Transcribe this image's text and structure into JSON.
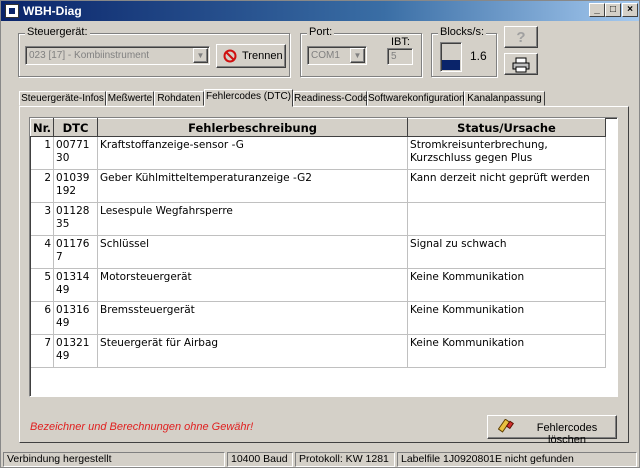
{
  "window": {
    "title": "WBH-Diag",
    "controls": {
      "minimize": "_",
      "maximize": "□",
      "close": "×"
    }
  },
  "controller": {
    "label": "Steuergerät:",
    "value": "023 [17] - Kombiinstrument",
    "disconnect_label": "Trennen"
  },
  "port": {
    "label": "Port:",
    "value": "COM1"
  },
  "ibt": {
    "label": "IBT:",
    "value": "5"
  },
  "blocks": {
    "label": "Blocks/s:",
    "value": "1.6",
    "level": 0.35
  },
  "tabs": [
    {
      "label": "Steuergeräte-Infos"
    },
    {
      "label": "Meßwerte"
    },
    {
      "label": "Rohdaten"
    },
    {
      "label": "Fehlercodes (DTC)"
    },
    {
      "label": "Readiness-Code"
    },
    {
      "label": "Softwarekonfiguration"
    },
    {
      "label": "Kanalanpassung"
    }
  ],
  "dtc_table": {
    "headers": [
      "Nr.",
      "DTC",
      "Fehlerbeschreibung",
      "Status/Ursache"
    ],
    "rows": [
      {
        "nr": "1",
        "dtc": "00771",
        "sub": "30",
        "desc": "Kraftstoffanzeige-sensor -G",
        "status": "Stromkreisunterbrechung,",
        "status2": "Kurzschluss gegen Plus"
      },
      {
        "nr": "2",
        "dtc": "01039",
        "sub": "192",
        "desc": "Geber Kühlmitteltemperaturanzeige -G2",
        "status": "Kann derzeit nicht geprüft werden",
        "status2": ""
      },
      {
        "nr": "3",
        "dtc": "01128",
        "sub": "35",
        "desc": "Lesespule Wegfahrsperre",
        "status": "",
        "status2": ""
      },
      {
        "nr": "4",
        "dtc": "01176",
        "sub": "7",
        "desc": "Schlüssel",
        "status": "Signal zu schwach",
        "status2": ""
      },
      {
        "nr": "5",
        "dtc": "01314",
        "sub": "49",
        "desc": "Motorsteuergerät",
        "status": "Keine Kommunikation",
        "status2": ""
      },
      {
        "nr": "6",
        "dtc": "01316",
        "sub": "49",
        "desc": "Bremssteuergerät",
        "status": "Keine Kommunikation",
        "status2": ""
      },
      {
        "nr": "7",
        "dtc": "01321",
        "sub": "49",
        "desc": "Steuergerät für Airbag",
        "status": "Keine Kommunikation",
        "status2": ""
      }
    ]
  },
  "note": "Bezeichner und Berechnungen ohne Gewähr!",
  "clear_button": "Fehlercodes löschen",
  "statusbar": {
    "connection": "Verbindung hergestellt",
    "baud": "10400 Baud",
    "protocol": "Protokoll: KW 1281",
    "labelfile": "Labelfile 1J0920801E nicht gefunden"
  },
  "colors": {
    "title_start": "#0a246a",
    "note": "#e02020",
    "blocks_bar": "#0a246a",
    "stop_icon": "#d01010"
  }
}
